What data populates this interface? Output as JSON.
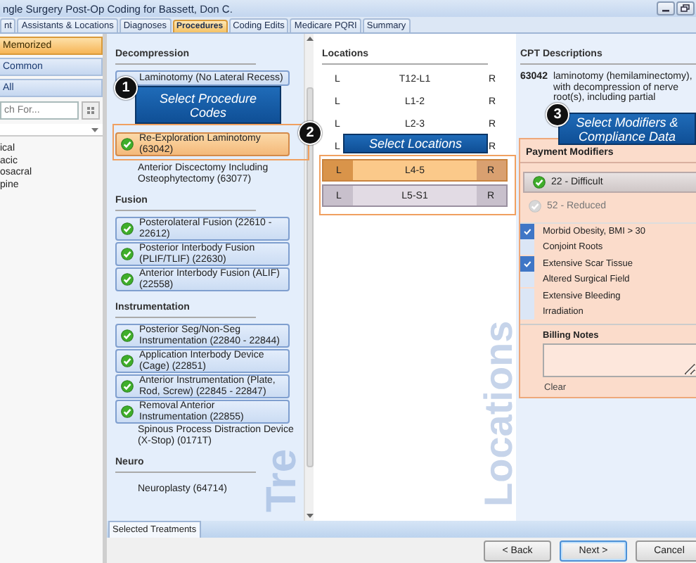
{
  "window": {
    "title": "ngle Surgery Post-Op Coding for Bassett, Don C."
  },
  "tabs": [
    {
      "label": "nt",
      "selected": false
    },
    {
      "label": "Assistants & Locations",
      "selected": false
    },
    {
      "label": "Diagnoses",
      "selected": false
    },
    {
      "label": "Procedures",
      "selected": true
    },
    {
      "label": "Coding Edits",
      "selected": false
    },
    {
      "label": "Medicare PQRI",
      "selected": false
    },
    {
      "label": "Summary",
      "selected": false
    }
  ],
  "sidebar": {
    "groups": [
      {
        "label": "Memorized",
        "selected": true
      },
      {
        "label": "Common",
        "selected": false
      },
      {
        "label": "All",
        "selected": false
      }
    ],
    "search": {
      "placeholder": "ch For..."
    },
    "tree": [
      "ical",
      "acic",
      "osacral",
      "pine"
    ]
  },
  "treatments": {
    "watermark": "Tre",
    "sections": [
      {
        "heading": "Decompression",
        "items": [
          {
            "kind": "box",
            "label": "Laminotomy (No Lateral Recess)",
            "checked": false,
            "selected": false
          },
          {
            "kind": "box",
            "label": "Re-Exploration Laminotomy (63042)",
            "checked": true,
            "selected": true
          },
          {
            "kind": "plain",
            "label": "Anterior Discectomy Including Osteophytectomy  (63077)",
            "checked": false,
            "selected": false
          }
        ]
      },
      {
        "heading": "Fusion",
        "items": [
          {
            "kind": "box",
            "label": "Posterolateral Fusion  (22610 - 22612)",
            "checked": true,
            "selected": false
          },
          {
            "kind": "box",
            "label": "Posterior Interbody Fusion (PLIF/TLIF)  (22630)",
            "checked": true,
            "selected": false
          },
          {
            "kind": "box",
            "label": "Anterior Interbody Fusion (ALIF)  (22558)",
            "checked": true,
            "selected": false
          }
        ]
      },
      {
        "heading": "Instrumentation",
        "items": [
          {
            "kind": "box",
            "label": "Posterior Seg/Non-Seg Instrumentation  (22840 - 22844)",
            "checked": true,
            "selected": false
          },
          {
            "kind": "box",
            "label": "Application Interbody Device (Cage)  (22851)",
            "checked": true,
            "selected": false
          },
          {
            "kind": "box",
            "label": "Anterior Instrumentation (Plate, Rod, Screw)  (22845 - 22847)",
            "checked": true,
            "selected": false
          },
          {
            "kind": "box",
            "label": "Removal Anterior Instrumentation  (22855)",
            "checked": true,
            "selected": false
          },
          {
            "kind": "plain",
            "label": "Spinous Process Distraction Device (X-Stop)  (0171T)",
            "checked": false,
            "selected": false
          }
        ]
      },
      {
        "heading": "Neuro",
        "items": [
          {
            "kind": "plain",
            "label": "Neuroplasty  (64714)",
            "checked": false,
            "selected": false
          }
        ]
      }
    ]
  },
  "locations": {
    "heading": "Locations",
    "watermark": "Locations",
    "rows": [
      {
        "left": "L",
        "level": "T12-L1",
        "right": "R",
        "selected": false,
        "focused": false
      },
      {
        "left": "L",
        "level": "L1-2",
        "right": "R",
        "selected": false,
        "focused": false
      },
      {
        "left": "L",
        "level": "L2-3",
        "right": "R",
        "selected": false,
        "focused": false
      },
      {
        "left": "L",
        "right": "R",
        "selected": false,
        "focused": false
      },
      {
        "left": "L",
        "level": "L4-5",
        "right": "R",
        "selected": true,
        "focused": true
      },
      {
        "left": "L",
        "level": "L5-S1",
        "right": "R",
        "selected": true,
        "focused": false
      }
    ]
  },
  "cpt": {
    "heading": "CPT Descriptions",
    "code": "63042",
    "description": "laminotomy (hemilaminectomy), with decompression of nerve root(s), including partial"
  },
  "payment_modifiers": {
    "heading": "Payment Modifiers",
    "modifiers": [
      {
        "label": "22 - Difficult",
        "checked": true
      },
      {
        "label": "52 - Reduced",
        "checked": false
      }
    ],
    "compliance": [
      {
        "label": "Morbid Obesity, BMI > 30",
        "checked": true
      },
      {
        "label": "Conjoint Roots",
        "checked": false
      },
      {
        "label": "Extensive Scar Tissue",
        "checked": true
      },
      {
        "label": "Altered Surgical Field",
        "checked": false
      },
      {
        "label": "Extensive Bleeding",
        "checked": false
      },
      {
        "label": "Irradiation",
        "checked": false
      }
    ],
    "billing_notes_label": "Billing Notes",
    "clear": "Clear"
  },
  "bottom_tabs": [
    {
      "label": "Selected Treatments",
      "selected": true
    }
  ],
  "buttons": [
    {
      "label": "< Back",
      "default": false
    },
    {
      "label": "Next >",
      "default": true
    },
    {
      "label": "Cancel",
      "default": false
    }
  ],
  "callouts": [
    {
      "number": "1",
      "label": "Select Procedure Codes"
    },
    {
      "number": "2",
      "label": "Select Locations"
    },
    {
      "number": "3",
      "label": "Select Modifiers & Compliance Data"
    }
  ]
}
